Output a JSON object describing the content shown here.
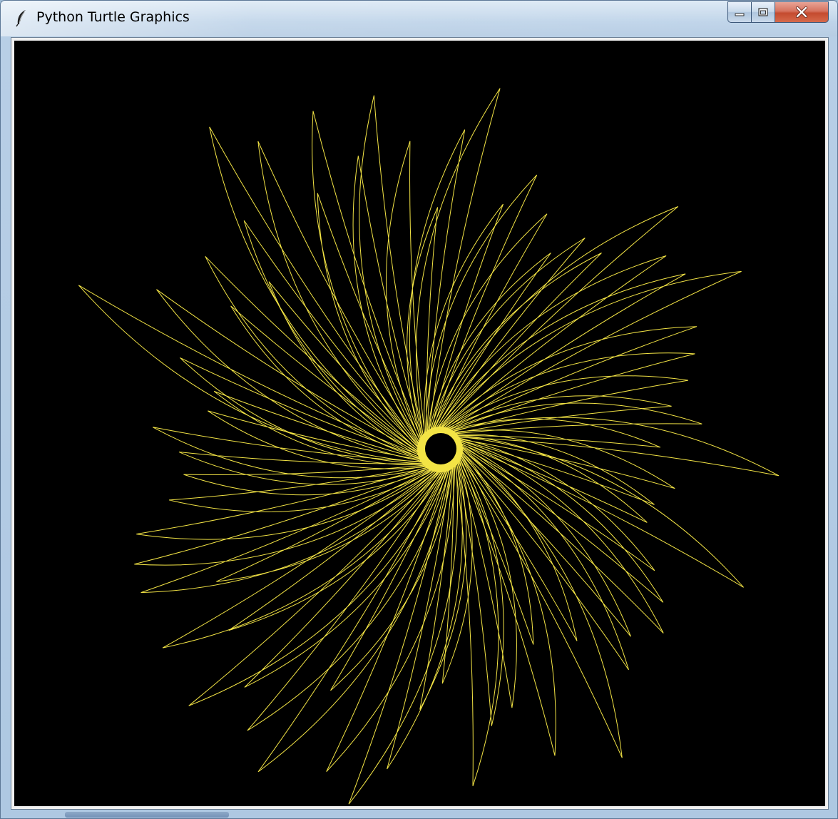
{
  "window": {
    "title": "Python Turtle Graphics"
  },
  "icons": {
    "app": "feather-icon",
    "minimize": "minimize-icon",
    "maximize": "maximize-icon",
    "close": "close-icon"
  },
  "colors": {
    "canvas_background": "#000000",
    "pen": "#f3e445",
    "close_button": "#c94b31"
  }
}
